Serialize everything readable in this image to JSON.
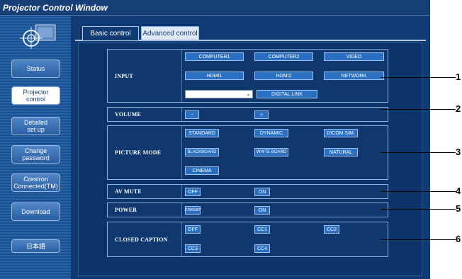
{
  "window": {
    "title": "Projector Control Window"
  },
  "sidebar": {
    "items": [
      {
        "label": "Status"
      },
      {
        "label": "Projector\ncontrol",
        "active": true
      },
      {
        "label": "Detailed\nset up"
      },
      {
        "label": "Change\npassword"
      },
      {
        "label": "Crestron\nConnected(TM)"
      },
      {
        "label": "Download"
      },
      {
        "label": "日本語"
      }
    ]
  },
  "tabs": [
    {
      "label": "Basic control",
      "selected": true
    },
    {
      "label": "Advanced control",
      "selected": false
    }
  ],
  "sections": {
    "input": {
      "label": "INPUT",
      "buttons": [
        "COMPUTER1",
        "COMPUTER2",
        "VIDEO",
        "HDMI1",
        "HDMI2",
        "NETWORK"
      ],
      "select_value": "",
      "digital_link": "DIGITAL LINK"
    },
    "volume": {
      "label": "VOLUME",
      "minus": "−",
      "plus": "+"
    },
    "picture_mode": {
      "label": "PICTURE MODE",
      "buttons": [
        "STANDARD",
        "DYNAMIC",
        "DICOM SIM.",
        "BLACKBOARD",
        "WHITE BOARD",
        "NATURAL",
        "CINEMA"
      ]
    },
    "av_mute": {
      "label": "AV MUTE",
      "off": "OFF",
      "on": "ON"
    },
    "power": {
      "label": "POWER",
      "standby": "STANDBY",
      "on": "ON"
    },
    "closed_caption": {
      "label": "CLOSED CAPTION",
      "buttons": [
        "OFF",
        "CC1",
        "CC2",
        "CC3",
        "CC4"
      ]
    }
  },
  "callouts": [
    "1",
    "2",
    "3",
    "4",
    "5",
    "6"
  ],
  "colors": {
    "background": "#0f3a73",
    "button": "#2b6fc2",
    "sidebar": "#2a64a8"
  }
}
